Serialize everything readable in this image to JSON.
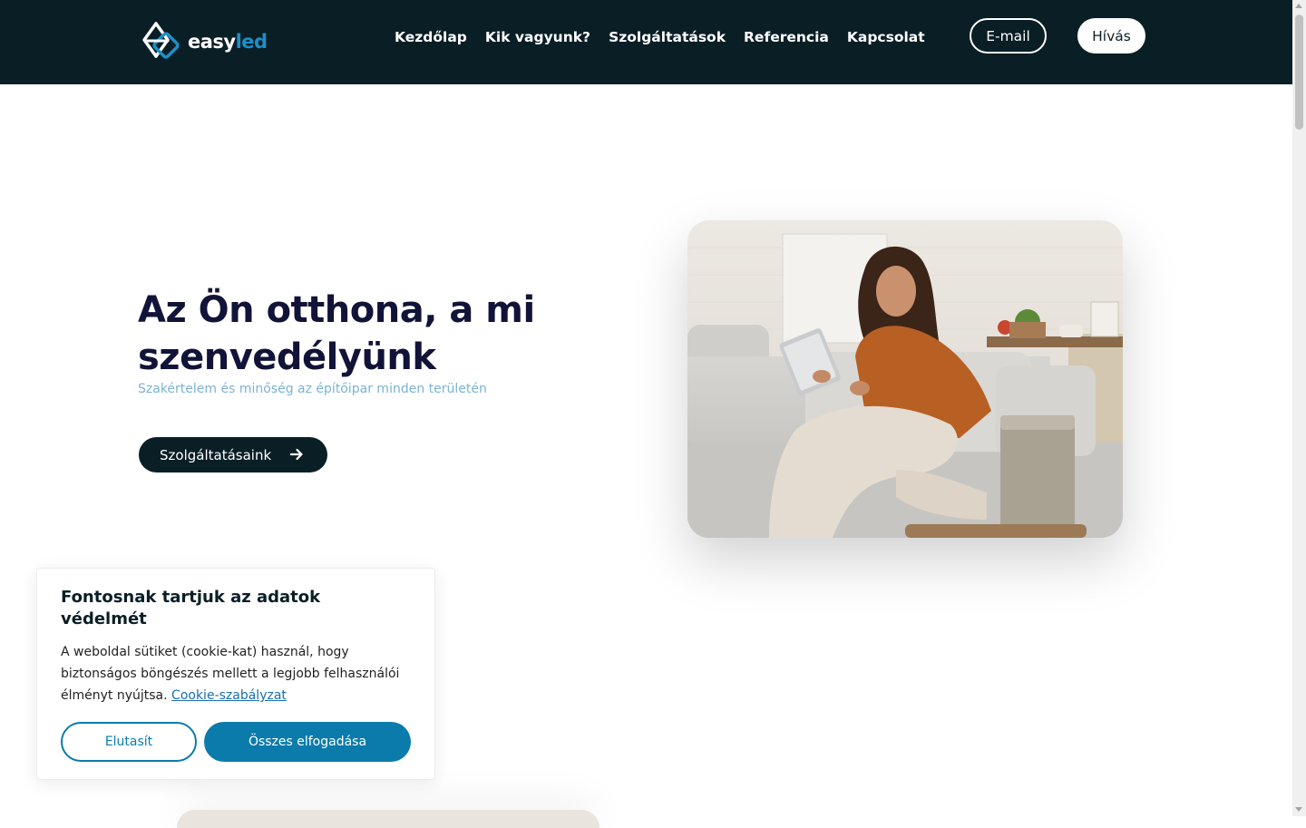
{
  "brand": {
    "easy": "easy",
    "led": "led",
    "accent_color": "#1d8fc7"
  },
  "nav": {
    "items": [
      {
        "label": "Kezdőlap"
      },
      {
        "label": "Kik vagyunk?"
      },
      {
        "label": "Szolgáltatások"
      },
      {
        "label": "Referencia"
      },
      {
        "label": "Kapcsolat"
      }
    ]
  },
  "header_buttons": {
    "email": "E-mail",
    "call": "Hívás"
  },
  "hero": {
    "title": "Az Ön otthona, a mi szenvedélyünk",
    "subtitle": "Szakértelem és minőség az építőipar minden területén",
    "cta": "Szolgáltatásaink",
    "cta_icon": "arrow-right-icon"
  },
  "cookie": {
    "title": "Fontosnak tartjuk az adatok védelmét",
    "text": "A weboldal sütiket (cookie-kat) használ, hogy biztonságos böngészés mellett a legjobb felhasználói élményt nyújtsa.",
    "link": "Cookie-szabályzat",
    "reject": "Elutasít",
    "accept": "Összes elfogadása"
  },
  "colors": {
    "header_bg": "#0a1e26",
    "title": "#111338",
    "subtitle": "#7bb3d3",
    "cookie_button": "#0b7bab"
  }
}
